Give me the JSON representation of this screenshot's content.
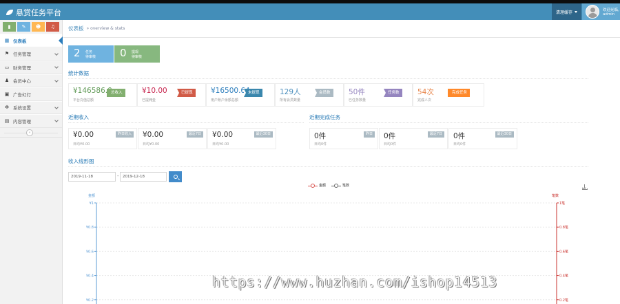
{
  "app": {
    "title": "悬赏任务平台"
  },
  "navbar": {
    "settings_label": "清理缓存",
    "user_greeting": "欢迎光临,",
    "user_name": "admin"
  },
  "shortcuts": [
    {
      "icon": "signal-icon"
    },
    {
      "icon": "pencil-icon"
    },
    {
      "icon": "users-icon"
    },
    {
      "icon": "bell-icon"
    }
  ],
  "sidebar": {
    "items": [
      {
        "label": "仪表板",
        "icon": "dashboard-icon",
        "active": true
      },
      {
        "label": "任务管理",
        "icon": "flag-icon"
      },
      {
        "label": "财务管理",
        "icon": "money-icon"
      },
      {
        "label": "会员中心",
        "icon": "user-icon"
      },
      {
        "label": "广告幻灯",
        "icon": "picture-icon"
      },
      {
        "label": "系统设置",
        "icon": "cog-icon"
      },
      {
        "label": "内容管理",
        "icon": "inbox-icon"
      }
    ]
  },
  "breadcrumb": {
    "title": "仪表板",
    "subtitle": "» overview & stats"
  },
  "tiles": [
    {
      "num": "2",
      "line1": "任务",
      "line2": "待审核",
      "color": "#6fb3e0"
    },
    {
      "num": "0",
      "line1": "提现",
      "line2": "待审核",
      "color": "#87b87f"
    }
  ],
  "stats_title": "统计数据",
  "stats": [
    {
      "value": "¥146586.0",
      "label": "平台充值总额",
      "badge": "总收入",
      "value_color": "#629b58",
      "badge_color": "#82af6f"
    },
    {
      "value": "¥10.00",
      "label": "已提佣金",
      "badge": "已提现",
      "value_color": "#c7254e",
      "badge_color": "#d15b47"
    },
    {
      "value": "¥16500.64",
      "label": "用户账户余额总额",
      "badge": "未提现",
      "value_color": "#2b7dbc",
      "badge_color": "#3a87ad"
    },
    {
      "value": "129人",
      "label": "所有会员数量",
      "badge": "会员数",
      "value_color": "#4c8fbd",
      "badge_color": "#abbac3"
    },
    {
      "value": "50件",
      "label": "已任务数量",
      "badge": "任务数",
      "value_color": "#9585bf",
      "badge_color": "#9585bf"
    },
    {
      "value": "54次",
      "label": "完成人次",
      "badge": "完成任务",
      "value_color": "#e8864b",
      "badge_color": "#ff892a"
    }
  ],
  "income": {
    "title": "近期收入",
    "items": [
      {
        "value": "¥0.00",
        "label": "日均¥0.00",
        "tag": "昨日收入"
      },
      {
        "value": "¥0.00",
        "label": "日均¥0.00",
        "tag": "最近7日"
      },
      {
        "value": "¥0.00",
        "label": "日均¥0.00",
        "tag": "最近30日"
      }
    ]
  },
  "tasks_done": {
    "title": "近期完成任务",
    "items": [
      {
        "value": "0件",
        "label": "日均0件",
        "tag": "昨日"
      },
      {
        "value": "0件",
        "label": "日均0件",
        "tag": "最近7日"
      },
      {
        "value": "0件",
        "label": "日均0件",
        "tag": "最近30日"
      }
    ]
  },
  "income_chart": {
    "title": "收入线形图",
    "date_from": "2019-11-18",
    "date_to": "2019-12-18",
    "date_separator": "-"
  },
  "watermark": "https://www.huzhan.com/ishop14513",
  "chart_data": {
    "type": "line",
    "series": [
      {
        "name": "金额",
        "values": [],
        "color": "#d9534f"
      },
      {
        "name": "笔数",
        "values": [],
        "color": "#666666"
      }
    ],
    "left_axis": {
      "label": "金额",
      "ticks": [
        "¥1",
        "¥0.8",
        "¥0.6",
        "¥0.4",
        "¥0.2"
      ],
      "color": "#5b9bd5",
      "ylim": [
        0,
        1
      ]
    },
    "right_axis": {
      "label": "笔数",
      "ticks": [
        "1笔",
        "0.8笔",
        "0.6笔",
        "0.4笔",
        "0.2笔"
      ],
      "color": "#c9302c",
      "ylim": [
        0,
        1
      ]
    },
    "grid": true,
    "legend": "top-center"
  }
}
